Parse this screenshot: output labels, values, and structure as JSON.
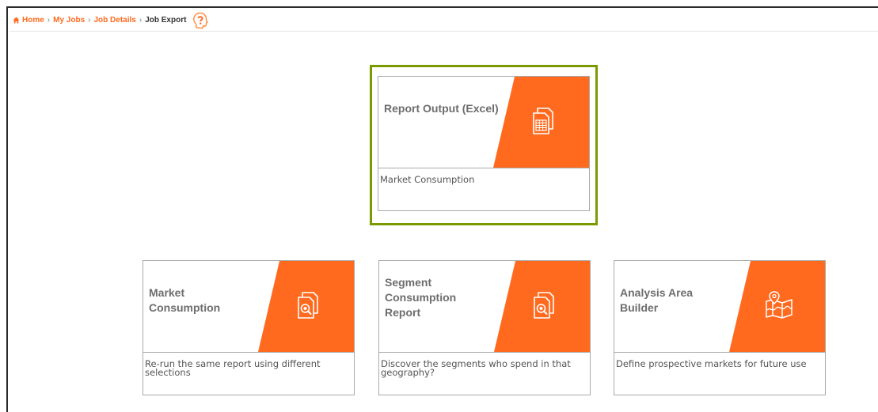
{
  "breadcrumb": {
    "home": "Home",
    "my_jobs": "My Jobs",
    "job_details": "Job Details",
    "current": "Job Export",
    "separator": "›"
  },
  "colors": {
    "accent": "#ff6a1f",
    "selected_outline": "#7a9a00",
    "card_border": "#a9a9a9",
    "title_text": "#6d6d6d"
  },
  "cards": [
    {
      "title": "Report Output (Excel)",
      "description": "Market Consumption",
      "icon": "excel-report-icon",
      "selected": true
    },
    {
      "title": "Market Consumption",
      "description": "Re-run the same report using different selections",
      "icon": "document-search-icon",
      "selected": false
    },
    {
      "title": "Segment Consumption Report",
      "description": "Discover the segments who spend in that geography?",
      "icon": "document-search-icon",
      "selected": false
    },
    {
      "title": "Analysis Area Builder",
      "description": "Define prospective markets for future use",
      "icon": "map-pin-icon",
      "selected": false
    }
  ]
}
